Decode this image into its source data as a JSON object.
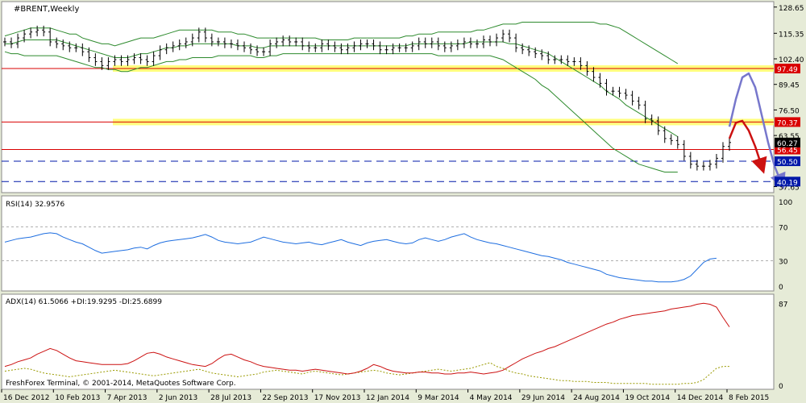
{
  "chart_data": {
    "type": "line",
    "symbol": "#BRENT,Weekly",
    "footer": "FreshForex Terminal, © 2001-2014, MetaQuotes Software Corp.",
    "price_ticks": [
      "128.65",
      "115.35",
      "102.40",
      "89.45",
      "76.50",
      "63.55",
      "37.65"
    ],
    "price_ylim": [
      35,
      131
    ],
    "dates": [
      "16 Dec 2012",
      "10 Feb 2013",
      "7 Apr 2013",
      "2 Jun 2013",
      "28 Jul 2013",
      "22 Sep 2013",
      "17 Nov 2013",
      "12 Jan 2014",
      "9 Mar 2014",
      "4 May 2014",
      "29 Jun 2014",
      "24 Aug 2014",
      "19 Oct 2014",
      "14 Dec 2014",
      "8 Feb 2015"
    ],
    "levels": [
      {
        "value": 97.49,
        "label": "97.49",
        "color": "#d90000",
        "zone": true
      },
      {
        "value": 70.37,
        "label": "70.37",
        "color": "#d90000",
        "zone": true
      },
      {
        "value": 56.45,
        "label": "56.45",
        "color": "#d90000",
        "zone": false
      },
      {
        "value": 50.5,
        "label": "50.50",
        "color": "#0018a8",
        "zone": false
      },
      {
        "value": 40.19,
        "label": "40.19",
        "color": "#0018a8",
        "zone": false
      }
    ],
    "current_price_label": "60.27",
    "series": [
      {
        "name": "Close",
        "color": "#000000",
        "values": [
          111,
          110,
          113,
          115,
          116,
          117,
          116,
          111,
          110,
          109,
          108,
          108,
          106,
          103,
          101,
          99,
          101,
          102,
          101,
          102,
          103,
          102,
          101,
          104,
          107,
          108,
          109,
          110,
          111,
          113,
          116,
          113,
          111,
          111,
          110,
          110,
          109,
          108,
          107,
          106,
          106,
          110,
          111,
          112,
          111,
          111,
          109,
          108,
          108,
          110,
          109,
          108,
          107,
          108,
          109,
          110,
          110,
          109,
          107,
          107,
          108,
          108,
          108,
          109,
          111,
          110,
          111,
          109,
          108,
          109,
          110,
          111,
          110,
          110,
          112,
          111,
          113,
          115,
          113,
          108,
          107,
          106,
          105,
          104,
          102,
          102,
          102,
          101,
          101,
          99,
          96,
          93,
          90,
          86,
          86,
          85,
          84,
          81,
          79,
          72,
          71,
          66,
          62,
          61,
          59,
          53,
          49,
          48,
          48,
          49,
          52,
          58,
          60
        ]
      },
      {
        "name": "BB Upper",
        "color": "#2e8b2e",
        "values": [
          114,
          115,
          116,
          117,
          118,
          118,
          118,
          118,
          117,
          116,
          115,
          115,
          113,
          112,
          111,
          110,
          110,
          109,
          110,
          111,
          112,
          113,
          113,
          113,
          114,
          115,
          116,
          117,
          117,
          117,
          117,
          117,
          117,
          116,
          116,
          116,
          115,
          115,
          114,
          113,
          113,
          113,
          113,
          113,
          113,
          113,
          113,
          113,
          113,
          112,
          112,
          112,
          112,
          112,
          113,
          113,
          113,
          113,
          113,
          113,
          113,
          113,
          114,
          114,
          115,
          115,
          115,
          116,
          116,
          116,
          116,
          116,
          116,
          117,
          117,
          118,
          119,
          120,
          120,
          120,
          121,
          121,
          121,
          121,
          121,
          121,
          121,
          121,
          121,
          121,
          121,
          121,
          120,
          120,
          119,
          118,
          116,
          114,
          112,
          110,
          108,
          106,
          104,
          102,
          100
        ]
      },
      {
        "name": "BB Middle",
        "color": "#2e8b2e",
        "values": [
          110,
          110,
          111,
          112,
          112,
          112,
          112,
          112,
          112,
          111,
          110,
          109,
          108,
          107,
          106,
          105,
          104,
          103,
          103,
          103,
          104,
          105,
          105,
          106,
          107,
          108,
          108,
          109,
          109,
          110,
          110,
          110,
          110,
          110,
          110,
          110,
          109,
          109,
          109,
          108,
          108,
          109,
          109,
          109,
          109,
          109,
          109,
          109,
          109,
          109,
          109,
          109,
          109,
          109,
          109,
          109,
          109,
          109,
          109,
          109,
          109,
          109,
          109,
          110,
          110,
          110,
          110,
          110,
          110,
          110,
          110,
          110,
          111,
          111,
          111,
          111,
          111,
          111,
          110,
          110,
          109,
          108,
          107,
          106,
          105,
          103,
          101,
          99,
          97,
          95,
          93,
          91,
          89,
          86,
          84,
          82,
          79,
          77,
          75,
          73,
          71,
          69,
          67,
          65,
          63
        ]
      },
      {
        "name": "BB Lower",
        "color": "#2e8b2e",
        "values": [
          106,
          105,
          105,
          104,
          104,
          104,
          104,
          104,
          104,
          103,
          102,
          101,
          100,
          99,
          98,
          98,
          97,
          97,
          96,
          96,
          97,
          98,
          98,
          99,
          100,
          101,
          101,
          102,
          102,
          103,
          103,
          103,
          103,
          104,
          104,
          104,
          104,
          104,
          104,
          103,
          103,
          104,
          104,
          105,
          105,
          105,
          105,
          105,
          105,
          105,
          105,
          105,
          105,
          105,
          105,
          105,
          105,
          105,
          105,
          105,
          105,
          105,
          105,
          105,
          105,
          105,
          105,
          104,
          104,
          104,
          104,
          104,
          104,
          104,
          104,
          104,
          103,
          102,
          100,
          98,
          96,
          94,
          92,
          89,
          87,
          84,
          81,
          78,
          75,
          72,
          69,
          66,
          63,
          60,
          57,
          55,
          53,
          51,
          49,
          48,
          47,
          46,
          45,
          45,
          45
        ]
      }
    ],
    "forecast": [
      {
        "name": "forecast-red",
        "color": "#cc1111",
        "x_start": 112,
        "values": [
          62,
          70,
          71,
          66,
          58,
          48
        ]
      },
      {
        "name": "forecast-blue",
        "color": "#7777cc",
        "x_start": 112,
        "values": [
          68,
          82,
          93,
          95,
          88,
          74,
          60,
          48,
          40
        ]
      }
    ],
    "rsi": {
      "label": "RSI(14) 32.9576",
      "ticks": [
        "100",
        "70",
        "30",
        "0"
      ],
      "levels": [
        70,
        30
      ],
      "color": "#1e6ee0",
      "values": [
        52,
        54,
        56,
        57,
        58,
        60,
        62,
        63,
        62,
        58,
        55,
        52,
        50,
        46,
        42,
        39,
        40,
        41,
        42,
        43,
        45,
        46,
        44,
        48,
        51,
        53,
        54,
        55,
        56,
        57,
        59,
        61,
        58,
        54,
        52,
        51,
        50,
        51,
        52,
        55,
        58,
        56,
        54,
        52,
        51,
        50,
        51,
        52,
        50,
        49,
        51,
        53,
        55,
        52,
        50,
        48,
        51,
        53,
        54,
        55,
        53,
        51,
        50,
        51,
        55,
        57,
        55,
        53,
        55,
        58,
        60,
        62,
        58,
        55,
        53,
        51,
        50,
        48,
        46,
        44,
        42,
        40,
        38,
        36,
        35,
        33,
        31,
        28,
        26,
        24,
        22,
        20,
        18,
        14,
        12,
        10,
        9,
        8,
        7,
        6,
        6,
        5,
        5,
        5,
        6,
        8,
        12,
        20,
        28,
        32,
        33
      ]
    },
    "adx": {
      "label": "ADX(14) 61.5066 +DI:19.9295 -DI:25.6899",
      "ticks": [
        "87",
        "0"
      ],
      "ylim": [
        0,
        95
      ],
      "adx_color": "#cc1111",
      "plus_di_color": "#9a9a00",
      "adx": [
        20,
        22,
        25,
        27,
        29,
        33,
        36,
        39,
        37,
        33,
        29,
        26,
        25,
        24,
        23,
        22,
        22,
        22,
        22,
        23,
        26,
        30,
        34,
        35,
        33,
        30,
        28,
        26,
        24,
        22,
        21,
        20,
        23,
        28,
        32,
        33,
        30,
        27,
        25,
        22,
        20,
        19,
        18,
        17,
        16,
        16,
        15,
        16,
        17,
        16,
        15,
        14,
        13,
        12,
        13,
        15,
        18,
        22,
        20,
        17,
        15,
        14,
        13,
        13,
        14,
        14,
        13,
        13,
        12,
        12,
        13,
        13,
        14,
        13,
        12,
        13,
        14,
        16,
        20,
        24,
        28,
        31,
        34,
        36,
        39,
        41,
        44,
        47,
        50,
        53,
        56,
        59,
        62,
        65,
        67,
        70,
        72,
        74,
        75,
        76,
        77,
        78,
        79,
        81,
        82,
        83,
        84,
        86,
        87,
        86,
        83,
        72,
        62
      ],
      "plus_di": [
        15,
        16,
        17,
        18,
        17,
        15,
        13,
        12,
        11,
        10,
        9,
        10,
        11,
        12,
        13,
        14,
        15,
        16,
        15,
        14,
        13,
        12,
        11,
        10,
        11,
        12,
        13,
        14,
        15,
        16,
        17,
        15,
        13,
        12,
        11,
        10,
        9,
        10,
        11,
        12,
        14,
        15,
        16,
        15,
        14,
        13,
        12,
        14,
        15,
        14,
        13,
        12,
        11,
        12,
        13,
        14,
        15,
        16,
        15,
        13,
        12,
        11,
        12,
        13,
        14,
        15,
        16,
        17,
        16,
        15,
        16,
        17,
        18,
        20,
        22,
        24,
        20,
        18,
        15,
        13,
        12,
        10,
        9,
        8,
        7,
        6,
        5,
        5,
        4,
        4,
        4,
        3,
        3,
        3,
        2,
        2,
        2,
        2,
        2,
        2,
        1,
        1,
        1,
        1,
        1,
        2,
        2,
        3,
        6,
        12,
        18,
        20,
        20
      ]
    }
  }
}
